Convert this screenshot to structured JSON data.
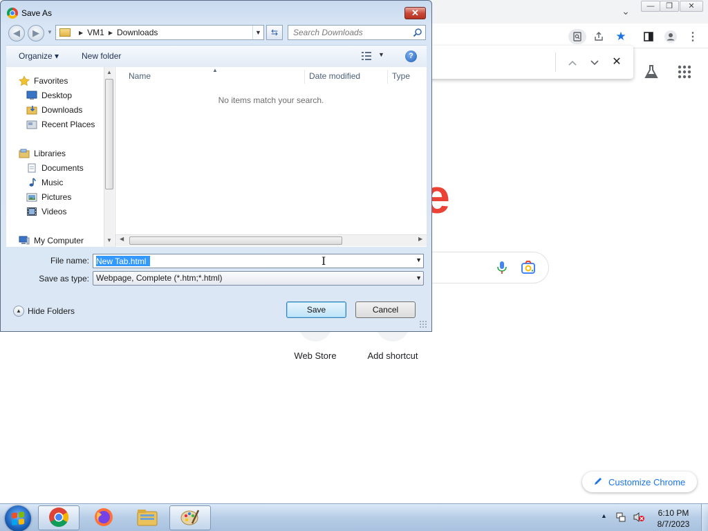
{
  "chrome": {
    "search_hint_letter": "e",
    "shortcuts": [
      {
        "label": "Web Store"
      },
      {
        "label": "Add shortcut"
      }
    ],
    "customize_label": "Customize Chrome"
  },
  "dialog": {
    "title": "Save As",
    "close_glyph": "✕",
    "breadcrumb": [
      "VM1",
      "Downloads"
    ],
    "search_placeholder": "Search Downloads",
    "commands": {
      "organize": "Organize ▾",
      "new_folder": "New folder",
      "help": "?"
    },
    "nav": {
      "favorites": {
        "label": "Favorites",
        "items": [
          "Desktop",
          "Downloads",
          "Recent Places"
        ]
      },
      "libraries": {
        "label": "Libraries",
        "items": [
          "Documents",
          "Music",
          "Pictures",
          "Videos"
        ]
      },
      "computer": "My Computer"
    },
    "columns": [
      "Name",
      "Date modified",
      "Type"
    ],
    "empty_message": "No items match your search.",
    "file_name_label": "File name:",
    "file_name_value": "New Tab.html",
    "save_type_label": "Save as type:",
    "save_type_value": "Webpage, Complete (*.htm;*.html)",
    "hide_folders": "Hide Folders",
    "save_button": "Save",
    "cancel_button": "Cancel"
  },
  "taskbar": {
    "time": "6:10 PM",
    "date": "8/7/2023"
  },
  "colors": {
    "chrome_red": "#ea4335",
    "chrome_blue": "#1a73e8",
    "selection": "#3399ff",
    "dialog_close": "#c94a3a"
  }
}
